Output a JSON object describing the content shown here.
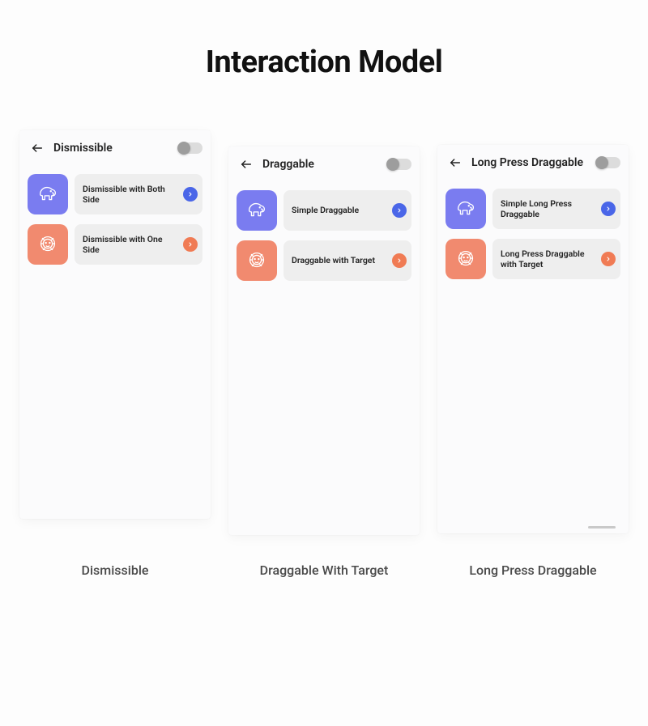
{
  "title": "Interaction Model",
  "colors": {
    "purple": "#7a7cf0",
    "coral": "#f18a6f",
    "chev_blue": "#4a66e8",
    "chev_orange": "#f07b54"
  },
  "phones": [
    {
      "header": "Dismissible",
      "caption": "Dismissible",
      "rows": [
        {
          "avatar": "elephant",
          "avatar_color": "purple",
          "label": "Dismissible with Both Side",
          "chev_color": "blue"
        },
        {
          "avatar": "lion",
          "avatar_color": "coral",
          "label": "Dismissible with One Side",
          "chev_color": "orange"
        }
      ]
    },
    {
      "header": "Draggable",
      "caption": "Draggable With Target",
      "rows": [
        {
          "avatar": "elephant",
          "avatar_color": "purple",
          "label": "Simple Draggable",
          "chev_color": "blue"
        },
        {
          "avatar": "lion",
          "avatar_color": "coral",
          "label": "Draggable with Target",
          "chev_color": "orange"
        }
      ]
    },
    {
      "header": "Long Press Draggable",
      "caption": "Long Press Draggable",
      "rows": [
        {
          "avatar": "elephant",
          "avatar_color": "purple",
          "label": "Simple Long Press Draggable",
          "chev_color": "blue"
        },
        {
          "avatar": "lion",
          "avatar_color": "coral",
          "label": "Long Press Draggable with Target",
          "chev_color": "orange"
        }
      ]
    }
  ]
}
